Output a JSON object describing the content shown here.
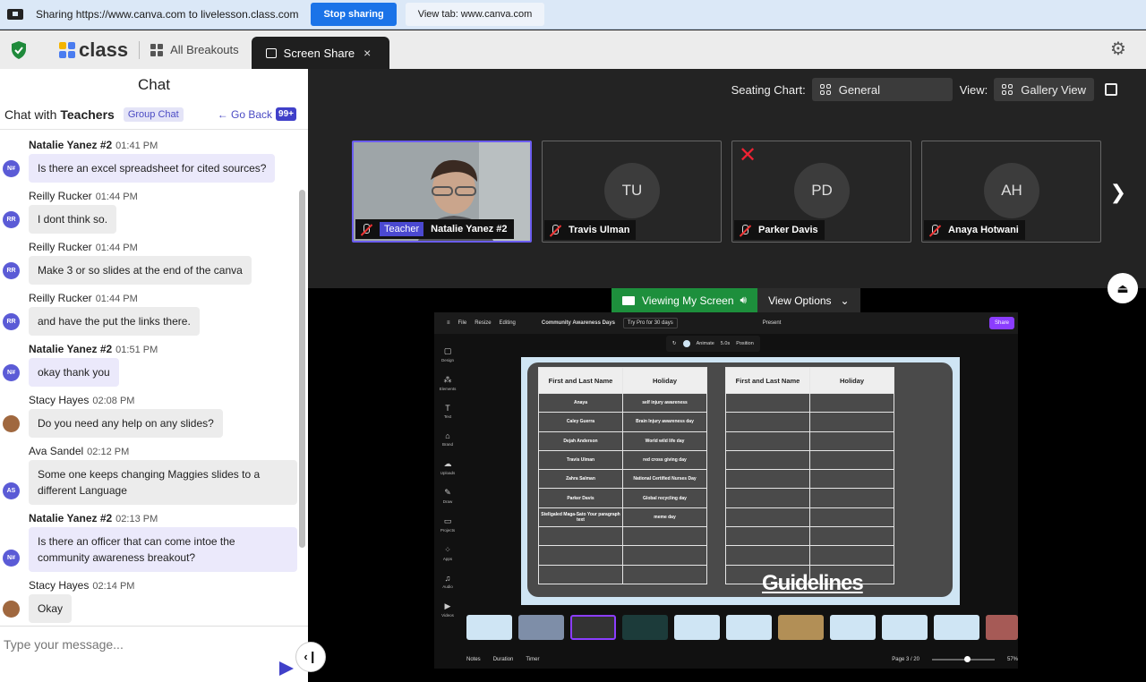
{
  "share_bar": {
    "message": "Sharing https://www.canva.com to livelesson.class.com",
    "stop_label": "Stop sharing",
    "view_tab_label": "View tab: www.canva.com"
  },
  "nav": {
    "logo_text": "class",
    "all_breakouts": "All Breakouts",
    "screen_share_tab": "Screen Share",
    "close_glyph": "×"
  },
  "chat": {
    "title": "Chat",
    "with_prefix": "Chat with",
    "with_name": "Teachers",
    "group_pill": "Group Chat",
    "go_back": "← Go Back",
    "unread": "99+",
    "input_placeholder": "Type your message...",
    "messages": [
      {
        "name": "Natalie Yanez #2",
        "time": "01:41 PM",
        "initials": "N#",
        "color": "#5b5bd6",
        "bold": true,
        "mine": true,
        "text": "Is there an excel spreadsheet for cited sources?"
      },
      {
        "name": "Reilly Rucker",
        "time": "01:44 PM",
        "initials": "RR",
        "color": "#5b5bd6",
        "bold": false,
        "mine": false,
        "text": "I dont think so."
      },
      {
        "name": "Reilly Rucker",
        "time": "01:44 PM",
        "initials": "RR",
        "color": "#5b5bd6",
        "bold": false,
        "mine": false,
        "text": "Make 3 or so slides at the end of the canva"
      },
      {
        "name": "Reilly Rucker",
        "time": "01:44 PM",
        "initials": "RR",
        "color": "#5b5bd6",
        "bold": false,
        "mine": false,
        "text": "and have the put the links there."
      },
      {
        "name": "Natalie Yanez #2",
        "time": "01:51 PM",
        "initials": "N#",
        "color": "#5b5bd6",
        "bold": true,
        "mine": true,
        "text": "okay thank you"
      },
      {
        "name": "Stacy Hayes",
        "time": "02:08 PM",
        "initials": "",
        "color": "#a0683f",
        "bold": false,
        "mine": false,
        "text": "Do you need any help on any slides?"
      },
      {
        "name": "Ava Sandel",
        "time": "02:12 PM",
        "initials": "AS",
        "color": "#5b5bd6",
        "bold": false,
        "mine": false,
        "text": "Some one keeps changing Maggies slides to a different Language"
      },
      {
        "name": "Natalie Yanez #2",
        "time": "02:13 PM",
        "initials": "N#",
        "color": "#5b5bd6",
        "bold": true,
        "mine": true,
        "text": "Is there an officer that can come intoe the community awareness breakout?"
      },
      {
        "name": "Stacy Hayes",
        "time": "02:14 PM",
        "initials": "",
        "color": "#a0683f",
        "bold": false,
        "mine": false,
        "text": "Okay"
      }
    ]
  },
  "video": {
    "seating_label": "Seating Chart:",
    "seating_value": "General",
    "view_label": "View:",
    "view_value": "Gallery View",
    "tiles": [
      {
        "initials": "",
        "name": "Natalie Yanez #2",
        "badge": "Teacher",
        "active": true,
        "removed": false
      },
      {
        "initials": "TU",
        "name": "Travis Ulman",
        "badge": "",
        "active": false,
        "removed": false
      },
      {
        "initials": "PD",
        "name": "Parker Davis",
        "badge": "",
        "active": false,
        "removed": true
      },
      {
        "initials": "AH",
        "name": "Anaya Hotwani",
        "badge": "",
        "active": false,
        "removed": false
      }
    ],
    "viewing_label": "Viewing My Screen",
    "view_options": "View Options"
  },
  "canva": {
    "file": "File",
    "resize": "Resize",
    "editing": "Editing",
    "doc_title": "Community Awareness Days",
    "try_pro": "Try Pro for 30 days",
    "present": "Present",
    "share": "Share",
    "toolbar": [
      "Animate",
      "5.0s",
      "Position"
    ],
    "sidebar": [
      "Design",
      "Elements",
      "Text",
      "Brand",
      "Uploads",
      "Draw",
      "Projects",
      "Apps",
      "Audio",
      "Videos"
    ],
    "table_headers": [
      "First and Last Name",
      "Holiday"
    ],
    "table_rows": [
      [
        "Anaya",
        "self injury awareness"
      ],
      [
        "Caley Guerra",
        "Brain Injury awareness day"
      ],
      [
        "Dejah Anderson",
        "World wild life day"
      ],
      [
        "Travis Ulman",
        "red cross giving day"
      ],
      [
        "Zahra Salman",
        "National Certified Nurses Day"
      ],
      [
        "Parker Davis",
        "Global recycling day"
      ],
      [
        "Stellgaled Maga-Sato Your paragraph text",
        "meme day"
      ],
      [
        "",
        ""
      ],
      [
        "",
        ""
      ],
      [
        "",
        ""
      ]
    ],
    "guidelines": "Guidelines",
    "bottom": {
      "notes": "Notes",
      "duration": "Duration",
      "timer": "Timer",
      "page": "Page 3 / 20",
      "zoom": "57%"
    }
  }
}
